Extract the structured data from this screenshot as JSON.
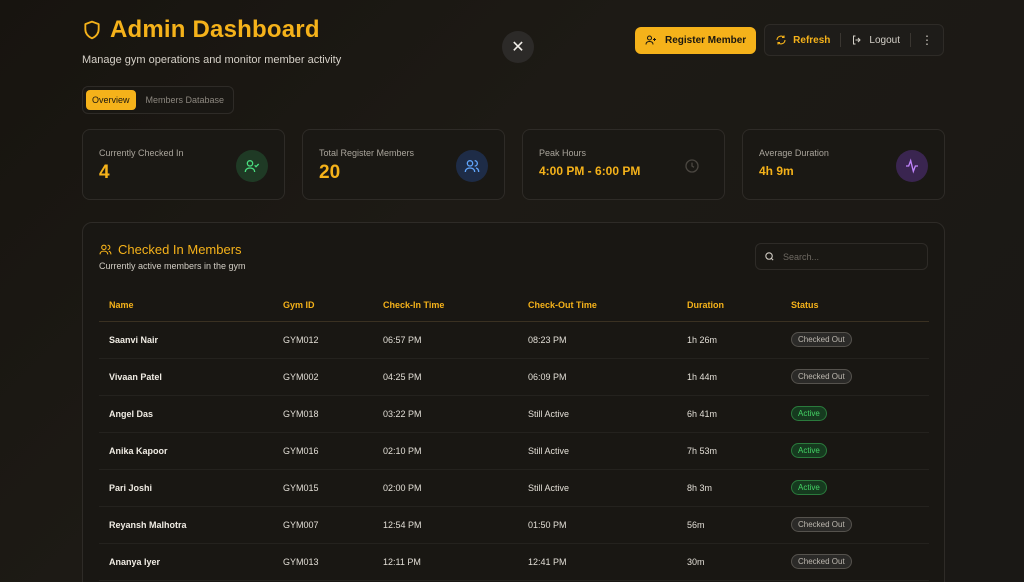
{
  "header": {
    "title": "Admin Dashboard",
    "subtitle": "Manage gym operations and monitor member activity"
  },
  "actions": {
    "register_label": "Register Member",
    "refresh_label": "Refresh",
    "logout_label": "Logout"
  },
  "tabs": [
    {
      "label": "Overview",
      "active": true
    },
    {
      "label": "Members Database",
      "active": false
    }
  ],
  "stats": [
    {
      "label": "Currently Checked In",
      "value": "4",
      "icon": "user-check-icon",
      "icon_color": "#4ade80"
    },
    {
      "label": "Total Register Members",
      "value": "20",
      "icon": "users-icon",
      "icon_color": "#60a5fa"
    },
    {
      "label": "Peak Hours",
      "value": "4:00 PM - 6:00 PM",
      "icon": "clock-icon",
      "icon_color": "#4a4640"
    },
    {
      "label": "Average Duration",
      "value": "4h 9m",
      "icon": "activity-icon",
      "icon_color": "#c084fc"
    }
  ],
  "panel": {
    "title": "Checked In Members",
    "subtitle": "Currently active members in the gym",
    "search_placeholder": "Search..."
  },
  "table": {
    "columns": [
      "Name",
      "Gym ID",
      "Check-In Time",
      "Check-Out Time",
      "Duration",
      "Status"
    ],
    "rows": [
      {
        "name": "Saanvi Nair",
        "gym_id": "GYM012",
        "check_in": "06:57 PM",
        "check_out": "08:23 PM",
        "duration": "1h 26m",
        "status": "Checked Out"
      },
      {
        "name": "Vivaan Patel",
        "gym_id": "GYM002",
        "check_in": "04:25 PM",
        "check_out": "06:09 PM",
        "duration": "1h 44m",
        "status": "Checked Out"
      },
      {
        "name": "Angel Das",
        "gym_id": "GYM018",
        "check_in": "03:22 PM",
        "check_out": "Still Active",
        "duration": "6h 41m",
        "status": "Active"
      },
      {
        "name": "Anika Kapoor",
        "gym_id": "GYM016",
        "check_in": "02:10 PM",
        "check_out": "Still Active",
        "duration": "7h 53m",
        "status": "Active"
      },
      {
        "name": "Pari Joshi",
        "gym_id": "GYM015",
        "check_in": "02:00 PM",
        "check_out": "Still Active",
        "duration": "8h 3m",
        "status": "Active"
      },
      {
        "name": "Reyansh Malhotra",
        "gym_id": "GYM007",
        "check_in": "12:54 PM",
        "check_out": "01:50 PM",
        "duration": "56m",
        "status": "Checked Out"
      },
      {
        "name": "Ananya Iyer",
        "gym_id": "GYM013",
        "check_in": "12:11 PM",
        "check_out": "12:41 PM",
        "duration": "30m",
        "status": "Checked Out"
      }
    ]
  },
  "colors": {
    "accent": "#f5b21a",
    "active_green": "#45d466",
    "background": "#1a1814"
  }
}
